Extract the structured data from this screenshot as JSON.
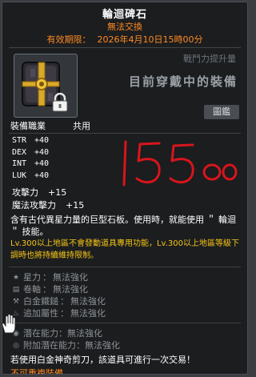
{
  "item": {
    "name": "輪迴碑石",
    "untradeable": "無法交換",
    "expiry_label": "有效期限：",
    "expiry_value": "2026年4月10日15時00分"
  },
  "panel": {
    "power_label": "戰鬥力提升量",
    "equipped_text": "目前穿戴中的裝備",
    "compare_button": "圖鑑"
  },
  "job": {
    "label": "裝備職業",
    "value": "共用"
  },
  "stats": [
    {
      "key": "STR",
      "value": "+40"
    },
    {
      "key": "DEX",
      "value": "+40"
    },
    {
      "key": "INT",
      "value": "+40"
    },
    {
      "key": "LUK",
      "value": "+40"
    }
  ],
  "attack": [
    {
      "key": "攻擊力",
      "value": "+15"
    },
    {
      "key": "魔法攻擊力",
      "value": "+15"
    }
  ],
  "description": "含有古代異星力量的巨型石板。使用時，就能使用 ＂ 輪迴 ＂ 技能。",
  "level_note": "Lv.300以上地區不會發動道具專用功能，Lv.300以上地區等級下調時也將持續維持限制。",
  "properties": [
    {
      "icon": "star-icon",
      "glyph": "★",
      "label": "星力",
      "value": "無法強化"
    },
    {
      "icon": "scroll-icon",
      "glyph": "▤",
      "label": "卷軸",
      "value": "無法強化"
    },
    {
      "icon": "hammer-icon",
      "glyph": "⚒",
      "label": "白金鐵鎚",
      "value": "無法強化"
    },
    {
      "icon": "flame-icon",
      "glyph": "♨",
      "label": "追加屬性",
      "value": "無法強化"
    }
  ],
  "potential": [
    {
      "icon": "potential-icon",
      "glyph": "◉",
      "label": "潛在能力",
      "value": "無法強化"
    },
    {
      "icon": "additional-potential-icon",
      "glyph": "◎",
      "label": "附加潛在能力",
      "value": "無法強化"
    }
  ],
  "scissors_note": "若使用白金神奇剪刀，該道具可進行一次交易！",
  "no_reuse": "不可重複裝備",
  "handwritten": "1550",
  "colors": {
    "accent_orange": "#ff8a22",
    "level_yellow": "#f6c515",
    "handwriting_red": "#d8151b",
    "background": "#1b1d1f"
  }
}
